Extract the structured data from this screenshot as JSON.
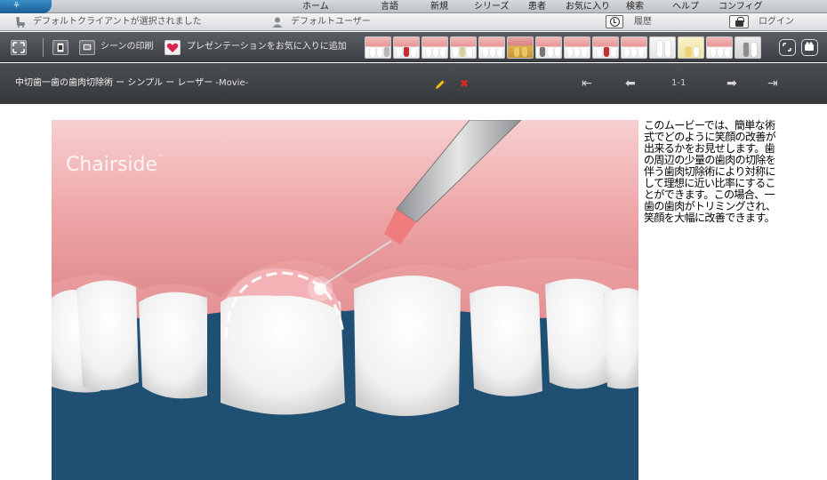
{
  "nav": {
    "items": [
      {
        "label": "ホーム"
      },
      {
        "label": "言語"
      },
      {
        "label": "新規"
      },
      {
        "label": "シリーズ"
      },
      {
        "label": "患者"
      },
      {
        "label": "お気に入り"
      },
      {
        "label": "検索"
      },
      {
        "label": "ヘルプ"
      },
      {
        "label": "コンフィグ"
      }
    ]
  },
  "status": {
    "client_text": "デフォルトクライアントが選択されました",
    "user_text": "デフォルトユーザー",
    "history_label": "履歴",
    "login_label": "ログイン"
  },
  "toolbar": {
    "print_label": "シーンの印刷",
    "favorite_label": "プレゼンテーションをお気に入りに追加"
  },
  "title": {
    "main": "中切歯一歯の歯肉切除術 ー シンプル ー レーザー",
    "suffix": "-Movie-",
    "pager": "1-1"
  },
  "player": {
    "watermark": "Chairside",
    "trademark": "™"
  },
  "description": "このムービーでは、簡単な術式でどのように笑顔の改善が出来るかをお見せします。歯の周辺の少量の歯肉の切除を伴う歯肉切除術により対称にして理想に近い比率にすることができます。この場合、一歯の歯肉がトリミングされ、笑顔を大幅に改善できます。",
  "icons": {
    "logo": "chairside-logo-icon",
    "fullscreen": "fullscreen-icon",
    "print": "print-icon",
    "favorite": "heart-icon",
    "edit": "pencil-icon",
    "delete": "close-icon"
  }
}
